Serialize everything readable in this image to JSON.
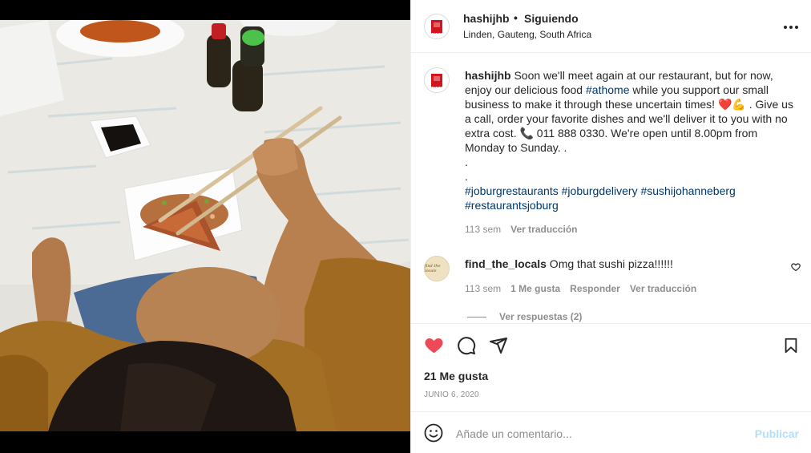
{
  "post": {
    "username": "hashijhb",
    "separator": "•",
    "follow_status": "Siguiendo",
    "location": "Linden, Gauteng, South Africa",
    "avatar_text": "HASHI"
  },
  "caption": {
    "username": "hashijhb",
    "text_1": " Soon we'll meet again at our restaurant, but for now, enjoy our delicious food ",
    "hashtag_1": "#athome",
    "text_2": " while you support our small business to make it through these uncertain times! ❤️💪 . Give us a call, order your favorite dishes and we'll deliver it to you with no extra cost. 📞 011 888 0330. We're open until 8.00pm from Monday to Sunday. .",
    "dot_1": ".",
    "dot_2": ".",
    "hashtags": [
      "#joburgrestaurants",
      "#joburgdelivery",
      "#sushijohanneberg",
      "#restaurantsjoburg"
    ],
    "age": "113 sem",
    "translate": "Ver traducción"
  },
  "comment": {
    "username": "find_the_locals",
    "text": " Omg that sushi pizza!!!!!!",
    "avatar_text": "find the locals",
    "age": "113 sem",
    "likes": "1 Me gusta",
    "reply": "Responder",
    "translate": "Ver traducción",
    "view_replies": "Ver respuestas (2)"
  },
  "actions": {
    "liked": true,
    "like_icon": "heart-filled-icon",
    "comment_icon": "comment-bubble-icon",
    "share_icon": "paper-plane-icon",
    "save_icon": "bookmark-icon",
    "likes_count": "21 Me gusta",
    "date": "JUNIO 6, 2020"
  },
  "composer": {
    "placeholder": "Añade un comentario...",
    "post_label": "Publicar",
    "emoji_icon": "smiley-icon"
  },
  "colors": {
    "heart": "#ed4956",
    "hashtag": "#00376b",
    "meta": "#8e8e8e",
    "post_disabled": "#b2dffc",
    "brand": "#d0151c"
  }
}
